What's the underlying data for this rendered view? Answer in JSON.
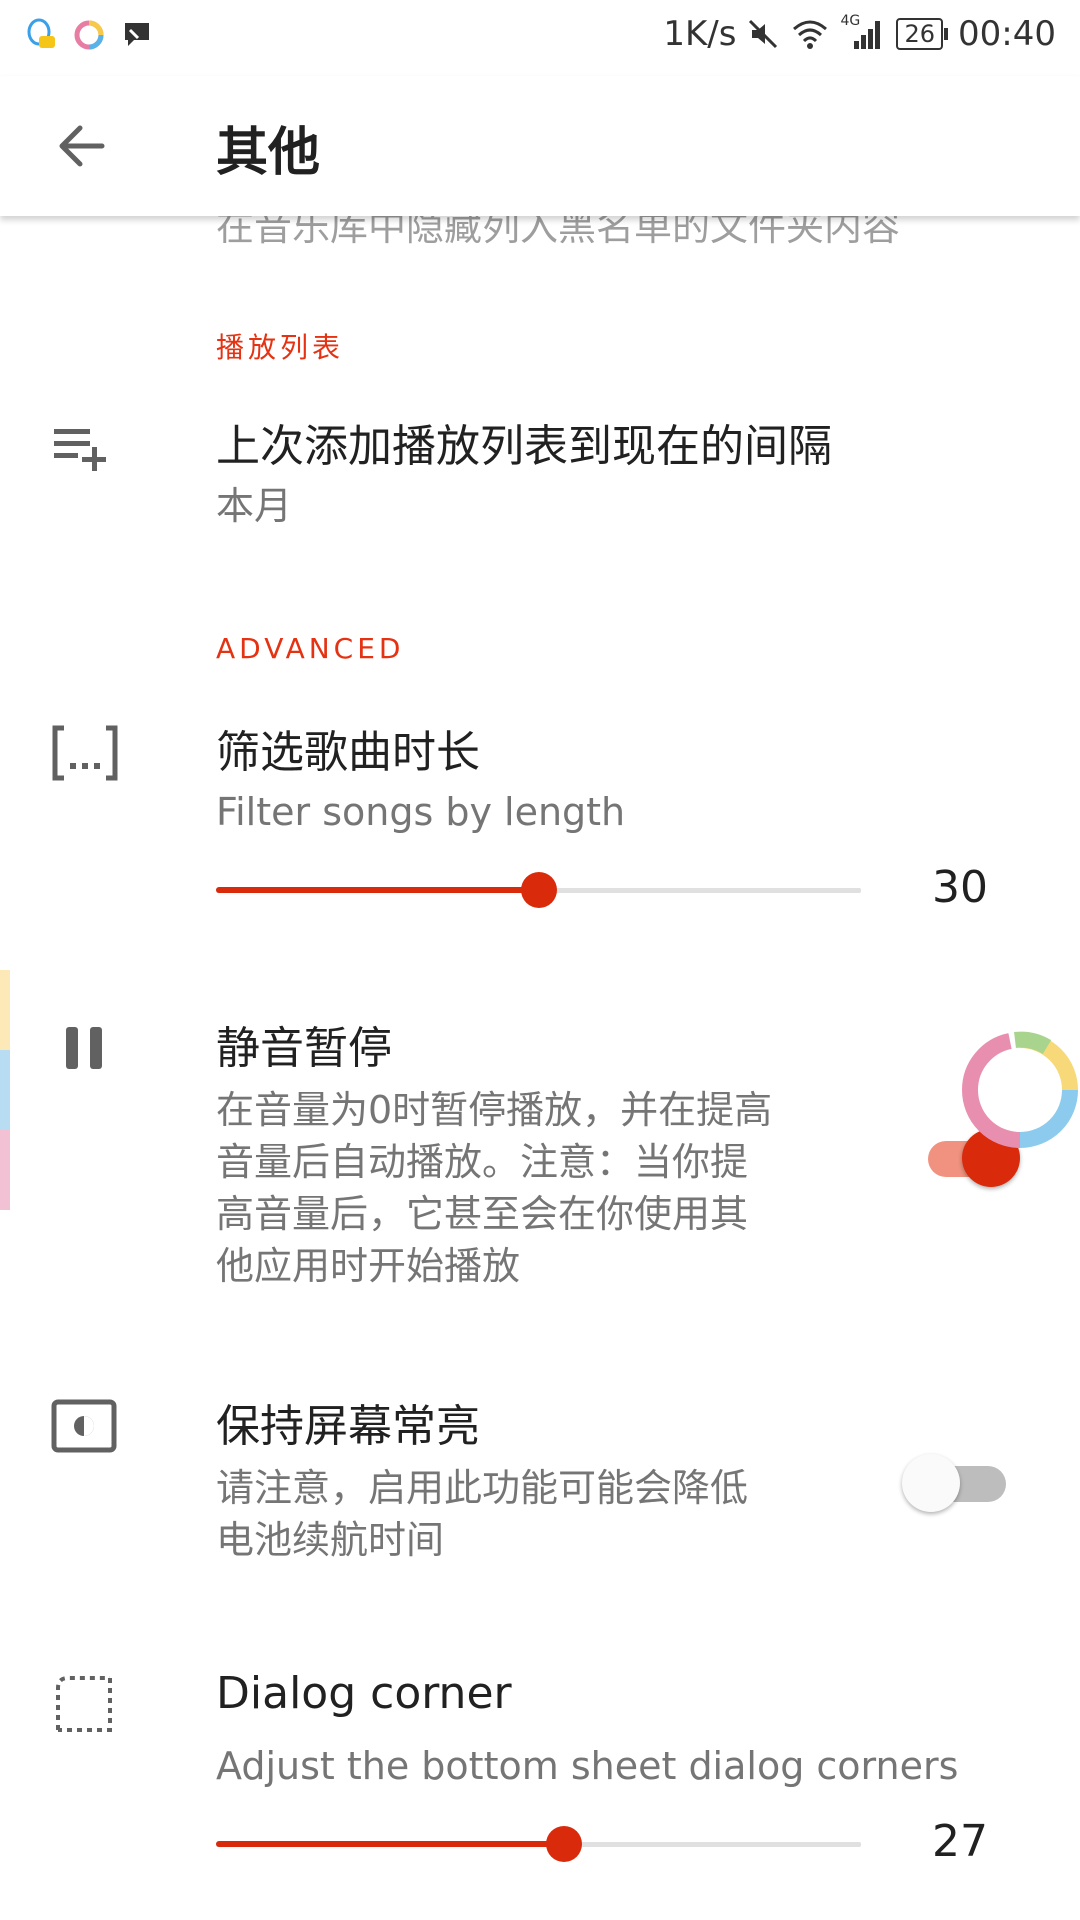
{
  "status_bar": {
    "speed": "1K/s",
    "network": "4G",
    "battery": "26",
    "time": "00:40"
  },
  "app_bar": {
    "title": "其他",
    "back_icon": "arrow-back-icon"
  },
  "partial_item_text": "在音乐库中隐藏列入黑名单的文件夹内容",
  "sections": {
    "playlist_header": "播放列表",
    "advanced_header": "ADVANCED"
  },
  "items": {
    "playlist_interval": {
      "icon": "playlist-add-icon",
      "title": "上次添加播放列表到现在的间隔",
      "subtitle": "本月"
    },
    "filter_length": {
      "icon": "bracket-ellipsis-icon",
      "title": "筛选歌曲时长",
      "subtitle": "Filter songs by length",
      "value": "30",
      "fraction": 0.5
    },
    "mute_pause": {
      "icon": "pause-icon",
      "title": "静音暂停",
      "subtitle_lines": [
        "在音量为0时暂停播放，并在提高",
        "音量后自动播放。注意：当你提",
        "高音量后，它甚至会在你使用其",
        "他应用时开始播放"
      ],
      "enabled": true
    },
    "keep_screen_on": {
      "icon": "brightness-screen-icon",
      "title": "保持屏幕常亮",
      "subtitle_lines": [
        "请注意，启用此功能可能会降低",
        "电池续航时间"
      ],
      "enabled": false
    },
    "dialog_corner": {
      "icon": "rounded-corner-icon",
      "title": "Dialog corner",
      "subtitle": "Adjust the bottom sheet dialog corners",
      "value": "27",
      "fraction": 0.54
    }
  },
  "colors": {
    "accent": "#d92b0c",
    "accent_light": "#f0927f",
    "section_header": "#e53212",
    "toggle_off_track": "#bdbdbd",
    "toggle_off_knob": "#fafafa"
  }
}
